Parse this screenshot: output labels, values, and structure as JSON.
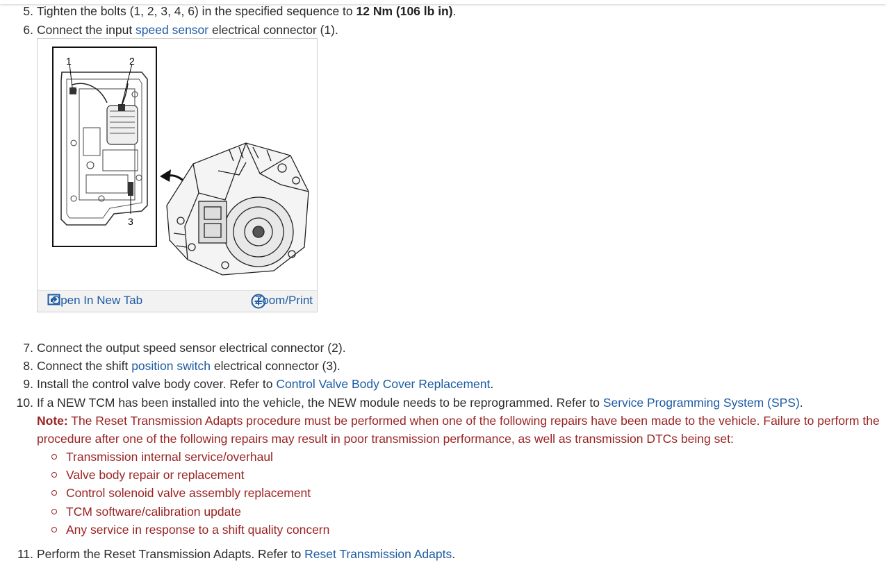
{
  "steps": {
    "s5": {
      "num": "5.",
      "pre": "Tighten the bolts (1, 2, 3, 4, 6) in the specified sequence to ",
      "bold": "12 Nm (106 lb in)",
      "post": "."
    },
    "s6": {
      "num": "6.",
      "pre": "Connect the input ",
      "link": "speed sensor",
      "post": " electrical connector (1)."
    },
    "s7": {
      "num": "7.",
      "text": "Connect the output speed sensor electrical connector (2)."
    },
    "s8": {
      "num": "8.",
      "pre": "Connect the shift ",
      "link": "position switch",
      "post": " electrical connector (3)."
    },
    "s9": {
      "num": "9.",
      "pre": "Install the control valve body cover. Refer to ",
      "link": "Control Valve Body Cover Replacement",
      "post": "."
    },
    "s10": {
      "num": "10.",
      "pre": "If a NEW TCM has been installed into the vehicle, the NEW module needs to be reprogrammed. Refer to ",
      "link": "Service Programming System (SPS)",
      "post": "."
    },
    "s11": {
      "num": "11.",
      "pre": "Perform the Reset Transmission Adapts. Refer to ",
      "link": "Reset Transmission Adapts",
      "post": "."
    }
  },
  "figure": {
    "callouts": [
      "1",
      "2",
      "3"
    ],
    "open_tab_label": "Open In New Tab",
    "zoom_label": "Zoom/Print",
    "open_icon": "open-new-tab-icon",
    "zoom_icon": "plus-circle-icon"
  },
  "note": {
    "label": "Note:",
    "text": " The Reset Transmission Adapts procedure must be performed when one of the following repairs have been made to the vehicle. Failure to perform the procedure after one of the following repairs may result in poor transmission performance, as well as transmission DTCs being set:",
    "bullets": [
      "Transmission internal service/overhaul",
      "Valve body repair or replacement",
      "Control solenoid valve assembly replacement",
      "TCM software/calibration update",
      "Any service in response to a shift quality concern"
    ]
  },
  "colors": {
    "link": "#1c5aa3",
    "note": "#9b2222",
    "text": "#2b2b2b"
  }
}
